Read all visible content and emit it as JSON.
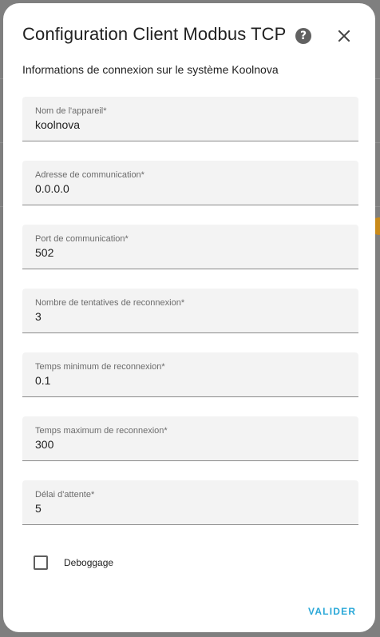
{
  "dialog": {
    "title": "Configuration Client Modbus TCP",
    "subtitle": "Informations de connexion sur le système Koolnova",
    "help_icon": "?",
    "close_icon": "close-icon"
  },
  "fields": [
    {
      "label": "Nom de l'appareil*",
      "value": "koolnova"
    },
    {
      "label": "Adresse de communication*",
      "value": "0.0.0.0"
    },
    {
      "label": "Port de communication*",
      "value": "502"
    },
    {
      "label": "Nombre de tentatives de reconnexion*",
      "value": "3"
    },
    {
      "label": "Temps minimum de reconnexion*",
      "value": "0.1"
    },
    {
      "label": "Temps maximum de reconnexion*",
      "value": "300"
    },
    {
      "label": "Délai d'attente*",
      "value": "5"
    }
  ],
  "debug": {
    "label": "Deboggage",
    "checked": false
  },
  "actions": {
    "submit_label": "VALIDER"
  },
  "colors": {
    "accent": "#2aa8d8",
    "field_bg": "#f3f3f3"
  }
}
